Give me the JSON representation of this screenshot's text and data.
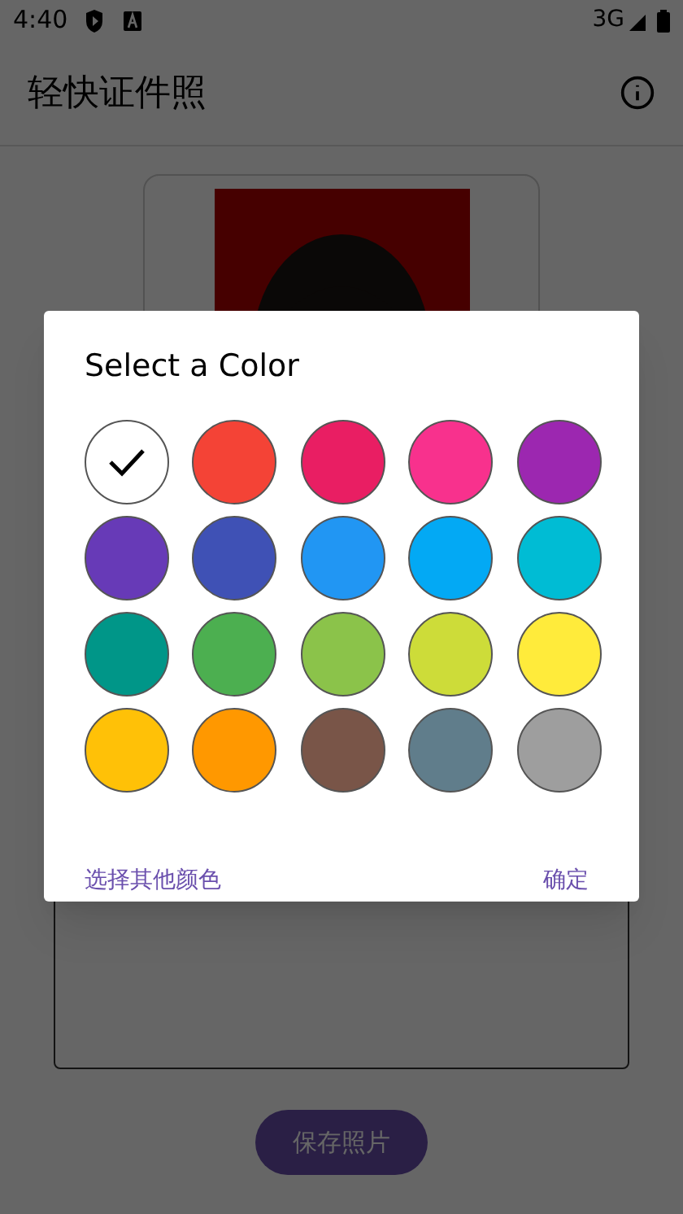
{
  "status_bar": {
    "time": "4:40",
    "network": "3G"
  },
  "app_bar": {
    "title": "轻快证件照"
  },
  "save_button": {
    "label": "保存照片"
  },
  "dialog": {
    "title": "Select a Color",
    "colors": [
      {
        "color": "#ffffff",
        "selected": true
      },
      {
        "color": "#f44336",
        "selected": false
      },
      {
        "color": "#e91e63",
        "selected": false
      },
      {
        "color": "#f8318d",
        "selected": false
      },
      {
        "color": "#9c27b0",
        "selected": false
      },
      {
        "color": "#673ab7",
        "selected": false
      },
      {
        "color": "#3f51b5",
        "selected": false
      },
      {
        "color": "#2196f3",
        "selected": false
      },
      {
        "color": "#03a9f4",
        "selected": false
      },
      {
        "color": "#00bcd4",
        "selected": false
      },
      {
        "color": "#009688",
        "selected": false
      },
      {
        "color": "#4caf50",
        "selected": false
      },
      {
        "color": "#8bc34a",
        "selected": false
      },
      {
        "color": "#cddc39",
        "selected": false
      },
      {
        "color": "#ffeb3b",
        "selected": false
      },
      {
        "color": "#ffc107",
        "selected": false
      },
      {
        "color": "#ff9800",
        "selected": false
      },
      {
        "color": "#795548",
        "selected": false
      },
      {
        "color": "#607d8b",
        "selected": false
      },
      {
        "color": "#9e9e9e",
        "selected": false
      }
    ],
    "other_button": "选择其他颜色",
    "ok_button": "确定"
  }
}
